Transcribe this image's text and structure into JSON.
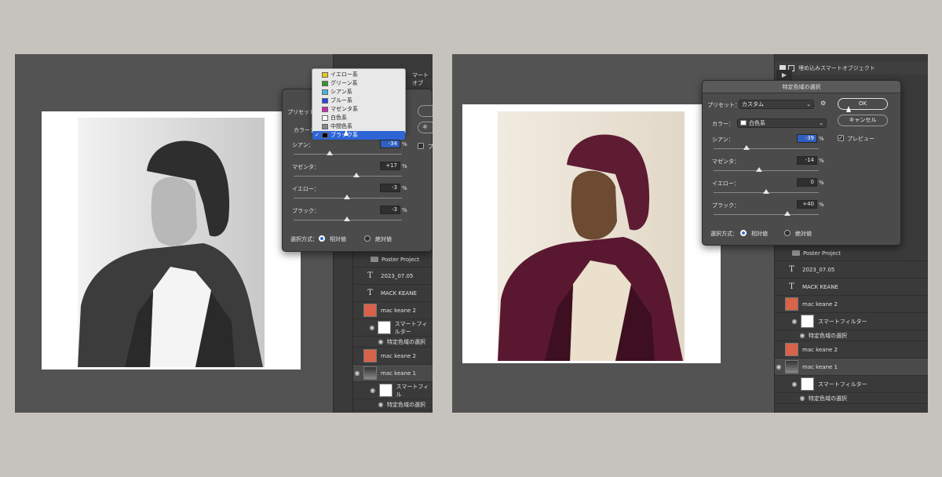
{
  "colors": {
    "bg": "#c6c3be",
    "app": "#535353",
    "panel": "#3a3a3a",
    "dialog": "#4b4b4b",
    "accent": "#2d64d6",
    "maroon_tint": "#5e1c33"
  },
  "left": {
    "dropdown_items": [
      {
        "label": "イエロー系",
        "swatch": "#e8c61a"
      },
      {
        "label": "グリーン系",
        "swatch": "#2f9a2a"
      },
      {
        "label": "シアン系",
        "swatch": "#3fb8e6"
      },
      {
        "label": "ブルー系",
        "swatch": "#1f49d8"
      },
      {
        "label": "マゼンタ系",
        "swatch": "#c92ab8"
      },
      {
        "label": "白色系",
        "swatch": "#ffffff"
      },
      {
        "label": "中間色系",
        "swatch": "#888888"
      },
      {
        "label": "ブラック系",
        "swatch": "#000000"
      }
    ],
    "selected_item": "ブラック系",
    "partial_top_text": "マートオブ",
    "dialog": {
      "preset_label": "プリセット",
      "color_label": "カラー：",
      "preview_partial": "プ",
      "cancel_partial": "キ",
      "sliders": [
        {
          "label": "シアン：",
          "value": "-34",
          "unit": "%",
          "pct": 0.33
        },
        {
          "label": "マゼンタ：",
          "value": "+17",
          "unit": "%",
          "pct": 0.58
        },
        {
          "label": "イエロー：",
          "value": "-3",
          "unit": "%",
          "pct": 0.49
        },
        {
          "label": "ブラック：",
          "value": "-3",
          "unit": "%",
          "pct": 0.49
        }
      ],
      "method_label": "選択方式：",
      "relative": "相対値",
      "absolute": "絶対値"
    },
    "layers": {
      "group": "Poster Project",
      "rows": [
        {
          "name": "2023_07.05",
          "kind": "text"
        },
        {
          "name": "MACK KEANE",
          "kind": "text"
        },
        {
          "name": "mac keane 2",
          "kind": "red"
        },
        {
          "name": "スマートフィルター",
          "kind": "white"
        },
        {
          "name": "特定色域の選択",
          "kind": "filter"
        },
        {
          "name": "mac keane 2",
          "kind": "red"
        },
        {
          "name": "mac keane 1",
          "kind": "photo"
        },
        {
          "name": "スマートフィル",
          "kind": "white"
        },
        {
          "name": "特定色域の選択",
          "kind": "filter"
        }
      ]
    }
  },
  "right": {
    "top_item": "埋め込みスマートオブジェクト",
    "dialog": {
      "title": "特定色域の選択",
      "preset_label": "プリセット：",
      "preset_value": "カスタム",
      "color_label": "カラー：",
      "color_value": "白色系",
      "ok": "OK",
      "cancel": "キャンセル",
      "preview": "プレビュー",
      "sliders": [
        {
          "label": "シアン：",
          "value": "-39",
          "unit": "%",
          "pct": 0.31
        },
        {
          "label": "マゼンタ：",
          "value": "-14",
          "unit": "%",
          "pct": 0.43
        },
        {
          "label": "イエロー：",
          "value": "0",
          "unit": "%",
          "pct": 0.5
        },
        {
          "label": "ブラック：",
          "value": "+40",
          "unit": "%",
          "pct": 0.7
        }
      ],
      "method_label": "選択方式：",
      "relative": "相対値",
      "absolute": "絶対値"
    },
    "layers": {
      "group": "Poster Project",
      "rows": [
        {
          "name": "2023_07.05",
          "kind": "text"
        },
        {
          "name": "MACK KEANE",
          "kind": "text"
        },
        {
          "name": "mac keane 2",
          "kind": "red"
        },
        {
          "name": "スマートフィルター",
          "kind": "white"
        },
        {
          "name": "特定色域の選択",
          "kind": "filter"
        },
        {
          "name": "mac keane 2",
          "kind": "red"
        },
        {
          "name": "mac keane 1",
          "kind": "photo"
        },
        {
          "name": "スマートフィルター",
          "kind": "white"
        },
        {
          "name": "特定色域の選択",
          "kind": "filter"
        }
      ]
    }
  }
}
